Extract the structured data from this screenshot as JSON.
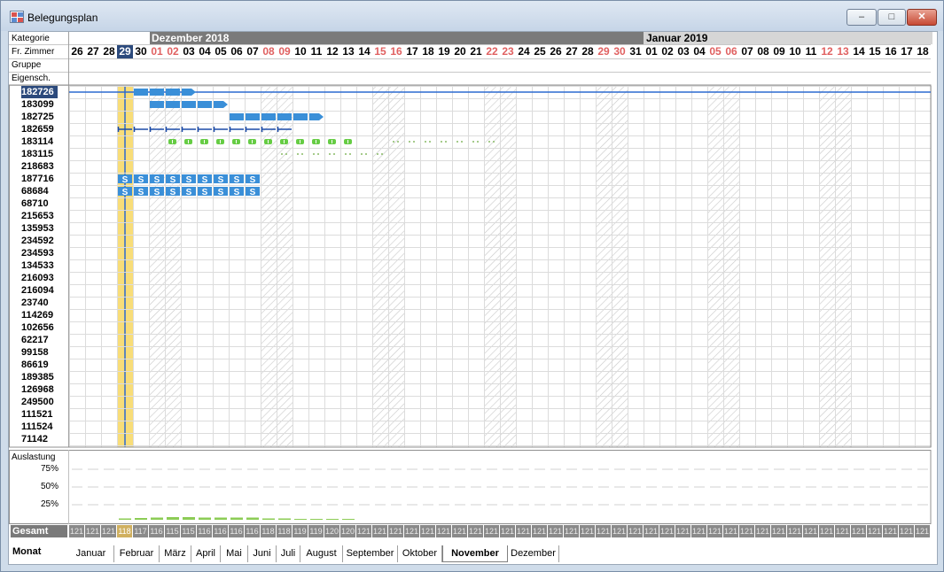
{
  "window": {
    "title": "Belegungsplan",
    "min_symbol": "‒",
    "max_symbol": "□",
    "close_symbol": "✕"
  },
  "header_labels": [
    "Kategorie",
    "Fr. Zimmer",
    "Gruppe",
    "Eigensch."
  ],
  "months": {
    "dec": "Dezember 2018",
    "jan": "Januar 2019"
  },
  "days": [
    "26",
    "27",
    "28",
    "29",
    "30",
    "01",
    "02",
    "03",
    "04",
    "05",
    "06",
    "07",
    "08",
    "09",
    "10",
    "11",
    "12",
    "13",
    "14",
    "15",
    "16",
    "17",
    "18",
    "19",
    "20",
    "21",
    "22",
    "23",
    "24",
    "25",
    "26",
    "27",
    "28",
    "29",
    "30",
    "31",
    "01",
    "02",
    "03",
    "04",
    "05",
    "06",
    "07",
    "08",
    "09",
    "10",
    "11",
    "12",
    "13",
    "14",
    "15",
    "16",
    "17",
    "18"
  ],
  "weekend_index": [
    5,
    6,
    12,
    13,
    19,
    20,
    26,
    27,
    33,
    34,
    40,
    41,
    47,
    48
  ],
  "today_index": 3,
  "rooms": [
    "182726",
    "183099",
    "182725",
    "182659",
    "183114",
    "183115",
    "218683",
    "187716",
    "68684",
    "68710",
    "215653",
    "135953",
    "234592",
    "234593",
    "134533",
    "216093",
    "216094",
    "23740",
    "114269",
    "102656",
    "62217",
    "99158",
    "86619",
    "189385",
    "126968",
    "249500",
    "111521",
    "111524",
    "71142"
  ],
  "selected_room_index": 0,
  "bookings": [
    {
      "row": 0,
      "start": 4,
      "end": 8,
      "style": "arrow",
      "color": "#3a8fd8"
    },
    {
      "row": 1,
      "start": 5,
      "end": 10,
      "style": "arrow",
      "color": "#3a8fd8"
    },
    {
      "row": 2,
      "start": 10,
      "end": 16,
      "style": "arrow",
      "color": "#3a8fd8"
    },
    {
      "row": 3,
      "start": 3,
      "end": 14,
      "style": "bracket",
      "color": "#1a4aa8"
    },
    {
      "row": 4,
      "start": 6,
      "end": 18,
      "style": "block",
      "color": "#66cc44"
    },
    {
      "row": 4,
      "start": 20,
      "end": 27,
      "style": "dots",
      "color": "#88bb66"
    },
    {
      "row": 5,
      "start": 13,
      "end": 20,
      "style": "dots",
      "color": "#88bb66"
    },
    {
      "row": 7,
      "start": 3,
      "end": 12,
      "style": "s",
      "color": "#3a8fd8"
    },
    {
      "row": 8,
      "start": 3,
      "end": 12,
      "style": "s",
      "color": "#3a8fd8"
    }
  ],
  "booking_letter": "S",
  "stats": {
    "title": "Auslastung",
    "ticks": [
      "75%",
      "50%",
      "25%"
    ]
  },
  "gesamt": {
    "label": "Gesamt",
    "values": [
      "121",
      "121",
      "121",
      "118",
      "117",
      "116",
      "115",
      "115",
      "116",
      "116",
      "116",
      "116",
      "118",
      "118",
      "119",
      "119",
      "120",
      "120",
      "121",
      "121",
      "121",
      "121",
      "121",
      "121",
      "121",
      "121",
      "121",
      "121",
      "121",
      "121",
      "121",
      "121",
      "121",
      "121",
      "121",
      "121",
      "121",
      "121",
      "121",
      "121",
      "121",
      "121",
      "121",
      "121",
      "121",
      "121",
      "121",
      "121",
      "121",
      "121",
      "121",
      "121",
      "121",
      "121"
    ]
  },
  "monat": {
    "label": "Monat",
    "tabs": [
      "Januar",
      "Februar",
      "März",
      "April",
      "Mai",
      "Juni",
      "Juli",
      "August",
      "September",
      "Oktober",
      "November",
      "Dezember"
    ],
    "active": 10
  }
}
